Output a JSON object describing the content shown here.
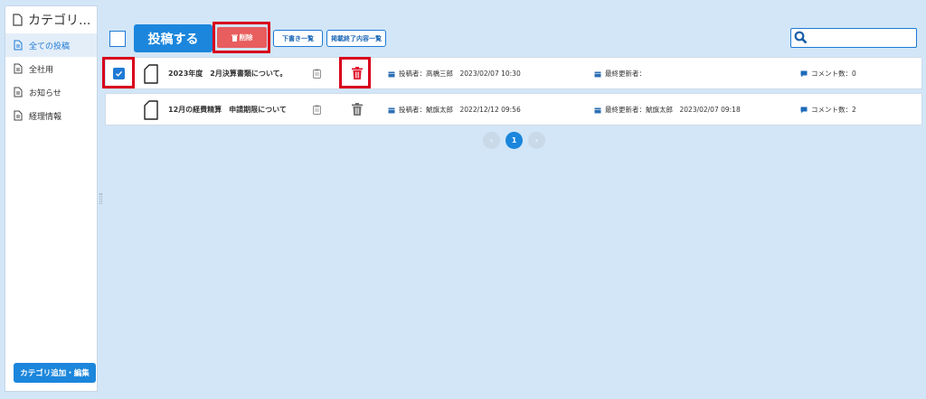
{
  "sidebar": {
    "title": "カテゴリ...",
    "items": [
      {
        "label": "全ての投稿",
        "active": true
      },
      {
        "label": "全社用",
        "active": false
      },
      {
        "label": "お知らせ",
        "active": false
      },
      {
        "label": "経理情報",
        "active": false
      }
    ],
    "edit_button": "カテゴリ追加・編集"
  },
  "toolbar": {
    "post_button": "投稿する",
    "delete_button": "削除",
    "drafts_button": "下書き一覧",
    "expired_button": "掲載終了内容一覧",
    "search_placeholder": ""
  },
  "posts": [
    {
      "checked": true,
      "title": "2023年度　2月決算書類について。",
      "author": "投稿者：高橋三郎　2023/02/07 10:30",
      "updater": "最終更新者：",
      "comments": "コメント数：0"
    },
    {
      "checked": false,
      "title": "12月の経費精算　申請期限について",
      "author": "投稿者：鯱旗太郎　2022/12/12 09:56",
      "updater": "最終更新者：鯱旗太郎　2023/02/07 09:18",
      "comments": "コメント数：2"
    }
  ],
  "pagination": {
    "prev": "‹",
    "current": "1",
    "next": "›"
  },
  "colors": {
    "accent": "#1b86dc",
    "highlight": "#d8001c",
    "background": "#d2e6f8"
  }
}
